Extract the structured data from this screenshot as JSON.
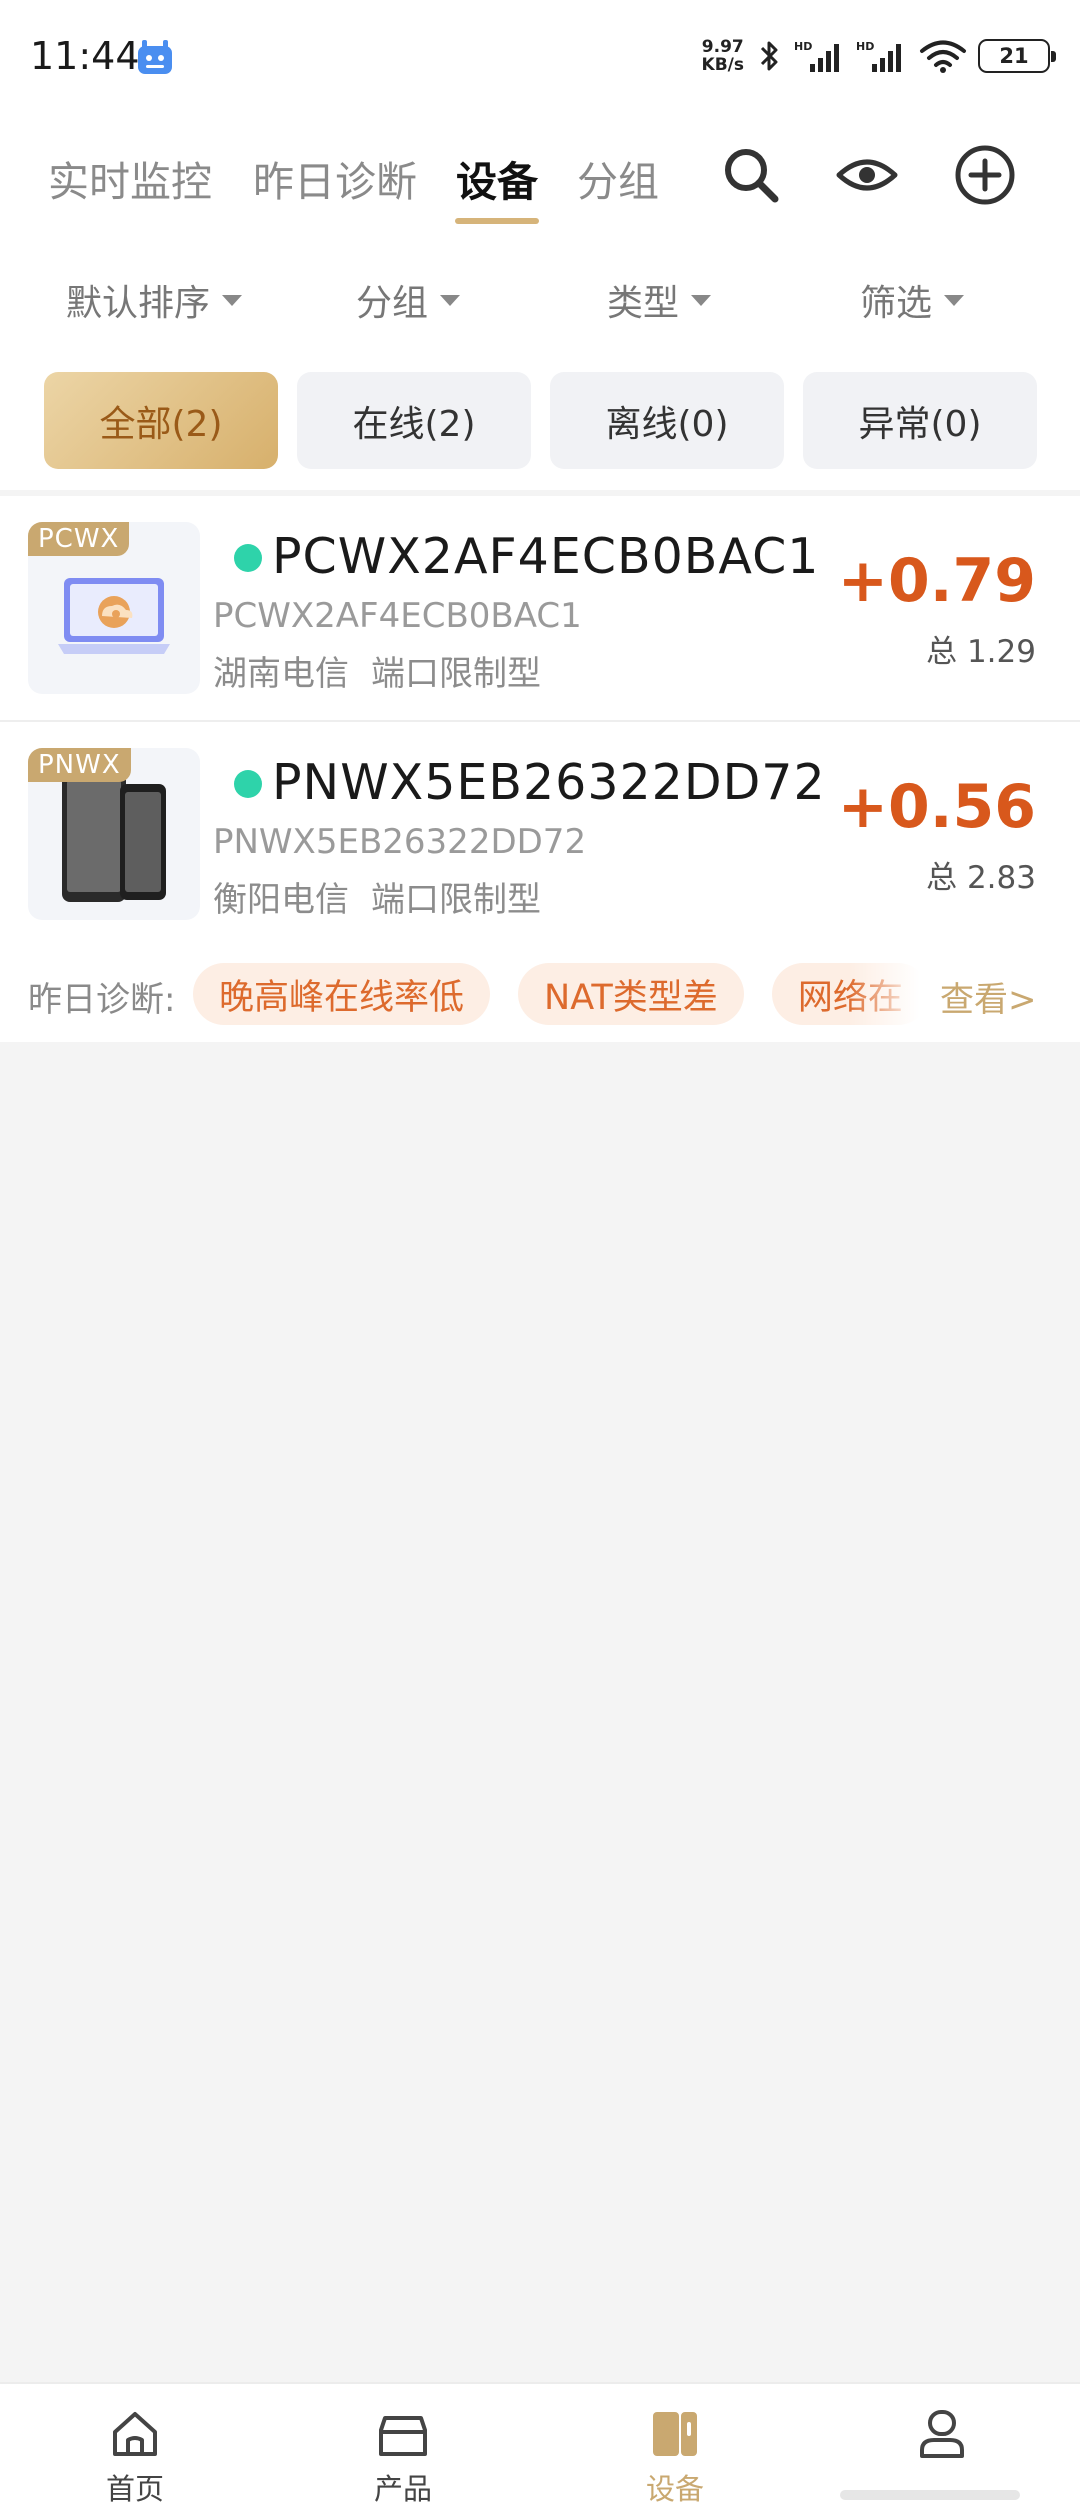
{
  "status_bar": {
    "time": "11:44",
    "net_speed_value": "9.97",
    "net_speed_unit": "KB/s",
    "battery": "21",
    "icons": [
      "app-notification-icon",
      "bluetooth-icon",
      "hd-signal-icon",
      "hd-signal-icon",
      "wifi-icon",
      "battery-icon"
    ]
  },
  "header": {
    "tabs": [
      {
        "label": "实时监控"
      },
      {
        "label": "昨日诊断"
      },
      {
        "label": "设备",
        "active": true
      },
      {
        "label": "分组"
      }
    ],
    "actions": [
      "search-icon",
      "eye-icon",
      "add-icon"
    ]
  },
  "filters": [
    {
      "label": "默认排序"
    },
    {
      "label": "分组"
    },
    {
      "label": "类型"
    },
    {
      "label": "筛选"
    }
  ],
  "segments": [
    {
      "label": "全部(2)",
      "active": true
    },
    {
      "label": "在线(2)"
    },
    {
      "label": "离线(0)"
    },
    {
      "label": "异常(0)"
    }
  ],
  "devices": [
    {
      "tag": "PCWX",
      "name": "PCWX2AF4ECB0BAC1",
      "id": "PCWX2AF4ECB0BAC1",
      "isp": "湖南电信",
      "nat_type": "端口限制型",
      "earnings": "+0.79",
      "total": "总 1.29",
      "status": "online",
      "icon": "laptop-cloud-icon"
    },
    {
      "tag": "PNWX",
      "name": "PNWX5EB26322DD72",
      "id": "PNWX5EB26322DD72",
      "isp": "衡阳电信",
      "nat_type": "端口限制型",
      "earnings": "+0.56",
      "total": "总 2.83",
      "status": "online",
      "icon": "phones-icon"
    }
  ],
  "diagnosis": {
    "label": "昨日诊断:",
    "chips": [
      "晚高峰在线率低",
      "NAT类型差",
      "网络在"
    ],
    "more": "查看>"
  },
  "bottom_nav": [
    {
      "label": "首页",
      "icon": "home-icon"
    },
    {
      "label": "产品",
      "icon": "product-box-icon"
    },
    {
      "label": "设备",
      "icon": "device-icon",
      "active": true
    },
    {
      "label": "",
      "icon": "user-icon"
    }
  ],
  "colors": {
    "accent_gold": "#d6b47a",
    "earnings_orange": "#d8581c",
    "online_green": "#2ed3aa",
    "chip_bg": "#fdeee4",
    "chip_text": "#dd6a2d"
  }
}
